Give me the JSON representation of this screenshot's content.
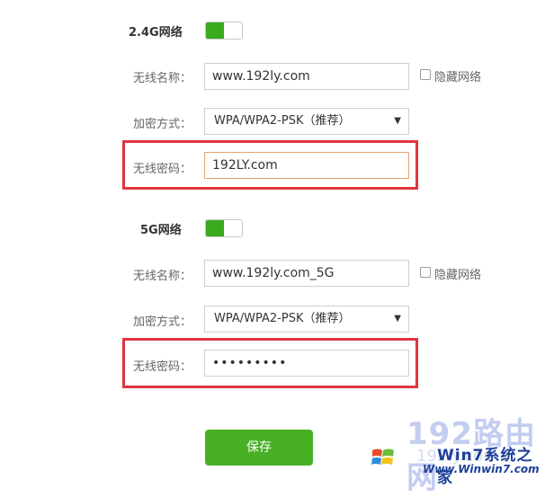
{
  "band_24g": {
    "title": "2.4G网络",
    "ssid_label": "无线名称：",
    "ssid_value": "www.192ly.com",
    "hide_label": "隐藏网络",
    "security_label": "加密方式：",
    "security_value": "WPA/WPA2-PSK（推荐）",
    "password_label": "无线密码：",
    "password_value": "192LY.com"
  },
  "band_5g": {
    "title": "5G网络",
    "ssid_label": "无线名称：",
    "ssid_value": "www.192ly.com_5G",
    "hide_label": "隐藏网络",
    "security_label": "加密方式：",
    "security_value": "WPA/WPA2-PSK（推荐）",
    "password_label": "无线密码：",
    "password_value": "•••••••••"
  },
  "save_label": "保存",
  "watermark": {
    "brand_top": "192路由网",
    "brand_bottom": "192ly.com",
    "win_site": "Win7系统之家",
    "win_url": "Www.Winwin7.com"
  },
  "colors": {
    "accent_green": "#3aaa1f",
    "save_green": "#48b025",
    "highlight_red": "#e0353f",
    "focus_orange": "#e7a36e"
  }
}
